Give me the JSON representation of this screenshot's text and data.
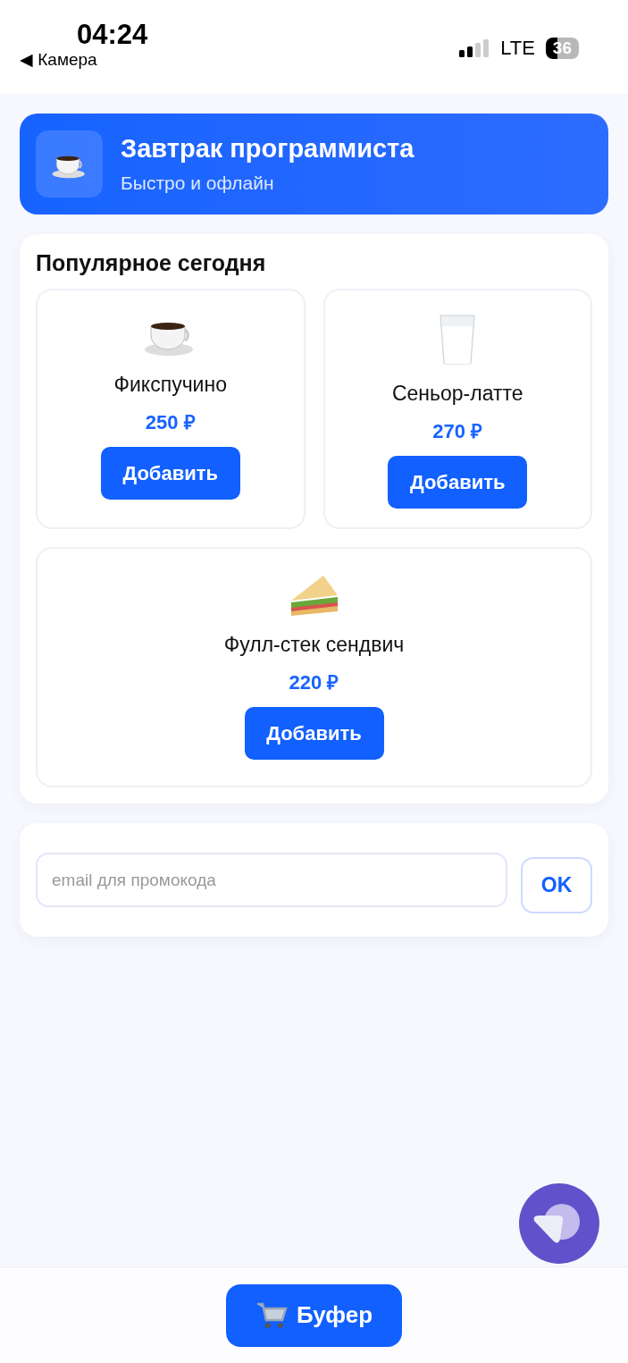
{
  "status_bar": {
    "time": "04:24",
    "back_label": "◀ Камера",
    "network": "LTE",
    "battery": "36"
  },
  "header": {
    "title": "Завтрак программиста",
    "subtitle": "Быстро и офлайн"
  },
  "popular": {
    "title": "Популярное сегодня",
    "items": [
      {
        "name": "Фикспучино",
        "price": "250 ₽",
        "button": "Добавить"
      },
      {
        "name": "Сеньор-латте",
        "price": "270 ₽",
        "button": "Добавить"
      },
      {
        "name": "Фулл-стек сендвич",
        "price": "220 ₽",
        "button": "Добавить"
      }
    ]
  },
  "promo": {
    "placeholder": "email для промокода",
    "button": "OK"
  },
  "bottom_bar": {
    "button": "Буфер"
  }
}
